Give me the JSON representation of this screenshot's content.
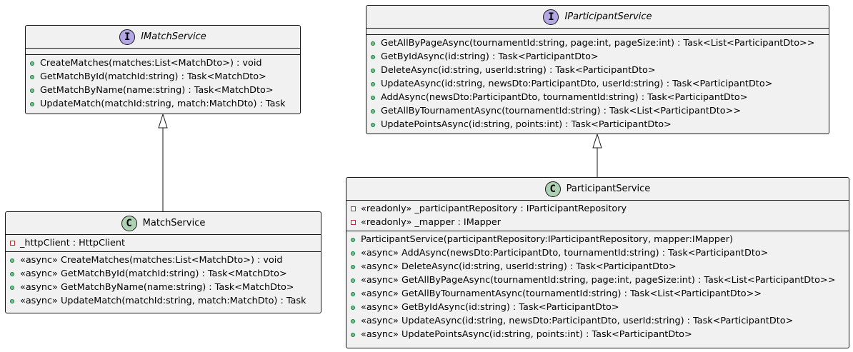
{
  "diagram": {
    "imatch_service": {
      "kind_letter": "I",
      "name": "IMatchService",
      "methods": [
        "CreateMatches(matches:List<MatchDto>) : void",
        "GetMatchById(matchId:string) : Task<MatchDto>",
        "GetMatchByName(name:string) : Task<MatchDto>",
        "UpdateMatch(matchId:string, match:MatchDto) : Task"
      ]
    },
    "match_service": {
      "kind_letter": "C",
      "name": "MatchService",
      "fields": [
        "_httpClient : HttpClient"
      ],
      "methods": [
        "«async» CreateMatches(matches:List<MatchDto>) : void",
        "«async» GetMatchById(matchId:string) : Task<MatchDto>",
        "«async» GetMatchByName(name:string) : Task<MatchDto>",
        "«async» UpdateMatch(matchId:string, match:MatchDto) : Task"
      ]
    },
    "iparticipant_service": {
      "kind_letter": "I",
      "name": "IParticipantService",
      "methods": [
        "GetAllByPageAsync(tournamentId:string, page:int, pageSize:int) : Task<List<ParticipantDto>>",
        "GetByIdAsync(id:string) : Task<ParticipantDto>",
        "DeleteAsync(id:string, userId:string) : Task<ParticipantDto>",
        "UpdateAsync(id:string, newsDto:ParticipantDto, userId:string) : Task<ParticipantDto>",
        "AddAsync(newsDto:ParticipantDto, tournamentId:string) : Task<ParticipantDto>",
        "GetAllByTournamentAsync(tournamentId:string) : Task<List<ParticipantDto>>",
        "UpdatePointsAsync(id:string, points:int) : Task<ParticipantDto>"
      ]
    },
    "participant_service": {
      "kind_letter": "C",
      "name": "ParticipantService",
      "fields": [
        "«readonly» _participantRepository : IParticipantRepository",
        "«readonly» _mapper : IMapper"
      ],
      "methods": [
        "ParticipantService(participantRepository:IParticipantRepository, mapper:IMapper)",
        "«async» AddAsync(newsDto:ParticipantDto, tournamentId:string) : Task<ParticipantDto>",
        "«async» DeleteAsync(id:string, userId:string) : Task<ParticipantDto>",
        "«async» GetAllByPageAsync(tournamentId:string, page:int, pageSize:int) : Task<List<ParticipantDto>>",
        "«async» GetAllByTournamentAsync(tournamentId:string) : Task<List<ParticipantDto>>",
        "«async» GetByIdAsync(id:string) : Task<ParticipantDto>",
        "«async» UpdateAsync(id:string, newsDto:ParticipantDto, userId:string) : Task<ParticipantDto>",
        "«async» UpdatePointsAsync(id:string, points:int) : Task<ParticipantDto>"
      ]
    }
  },
  "colors": {
    "box_fill": "#f1f1f1",
    "border": "#181818",
    "interface_badge": "#b4a7e5",
    "class_badge": "#add1b2",
    "public_marker": "#84be84",
    "private_marker": "#c82930"
  }
}
